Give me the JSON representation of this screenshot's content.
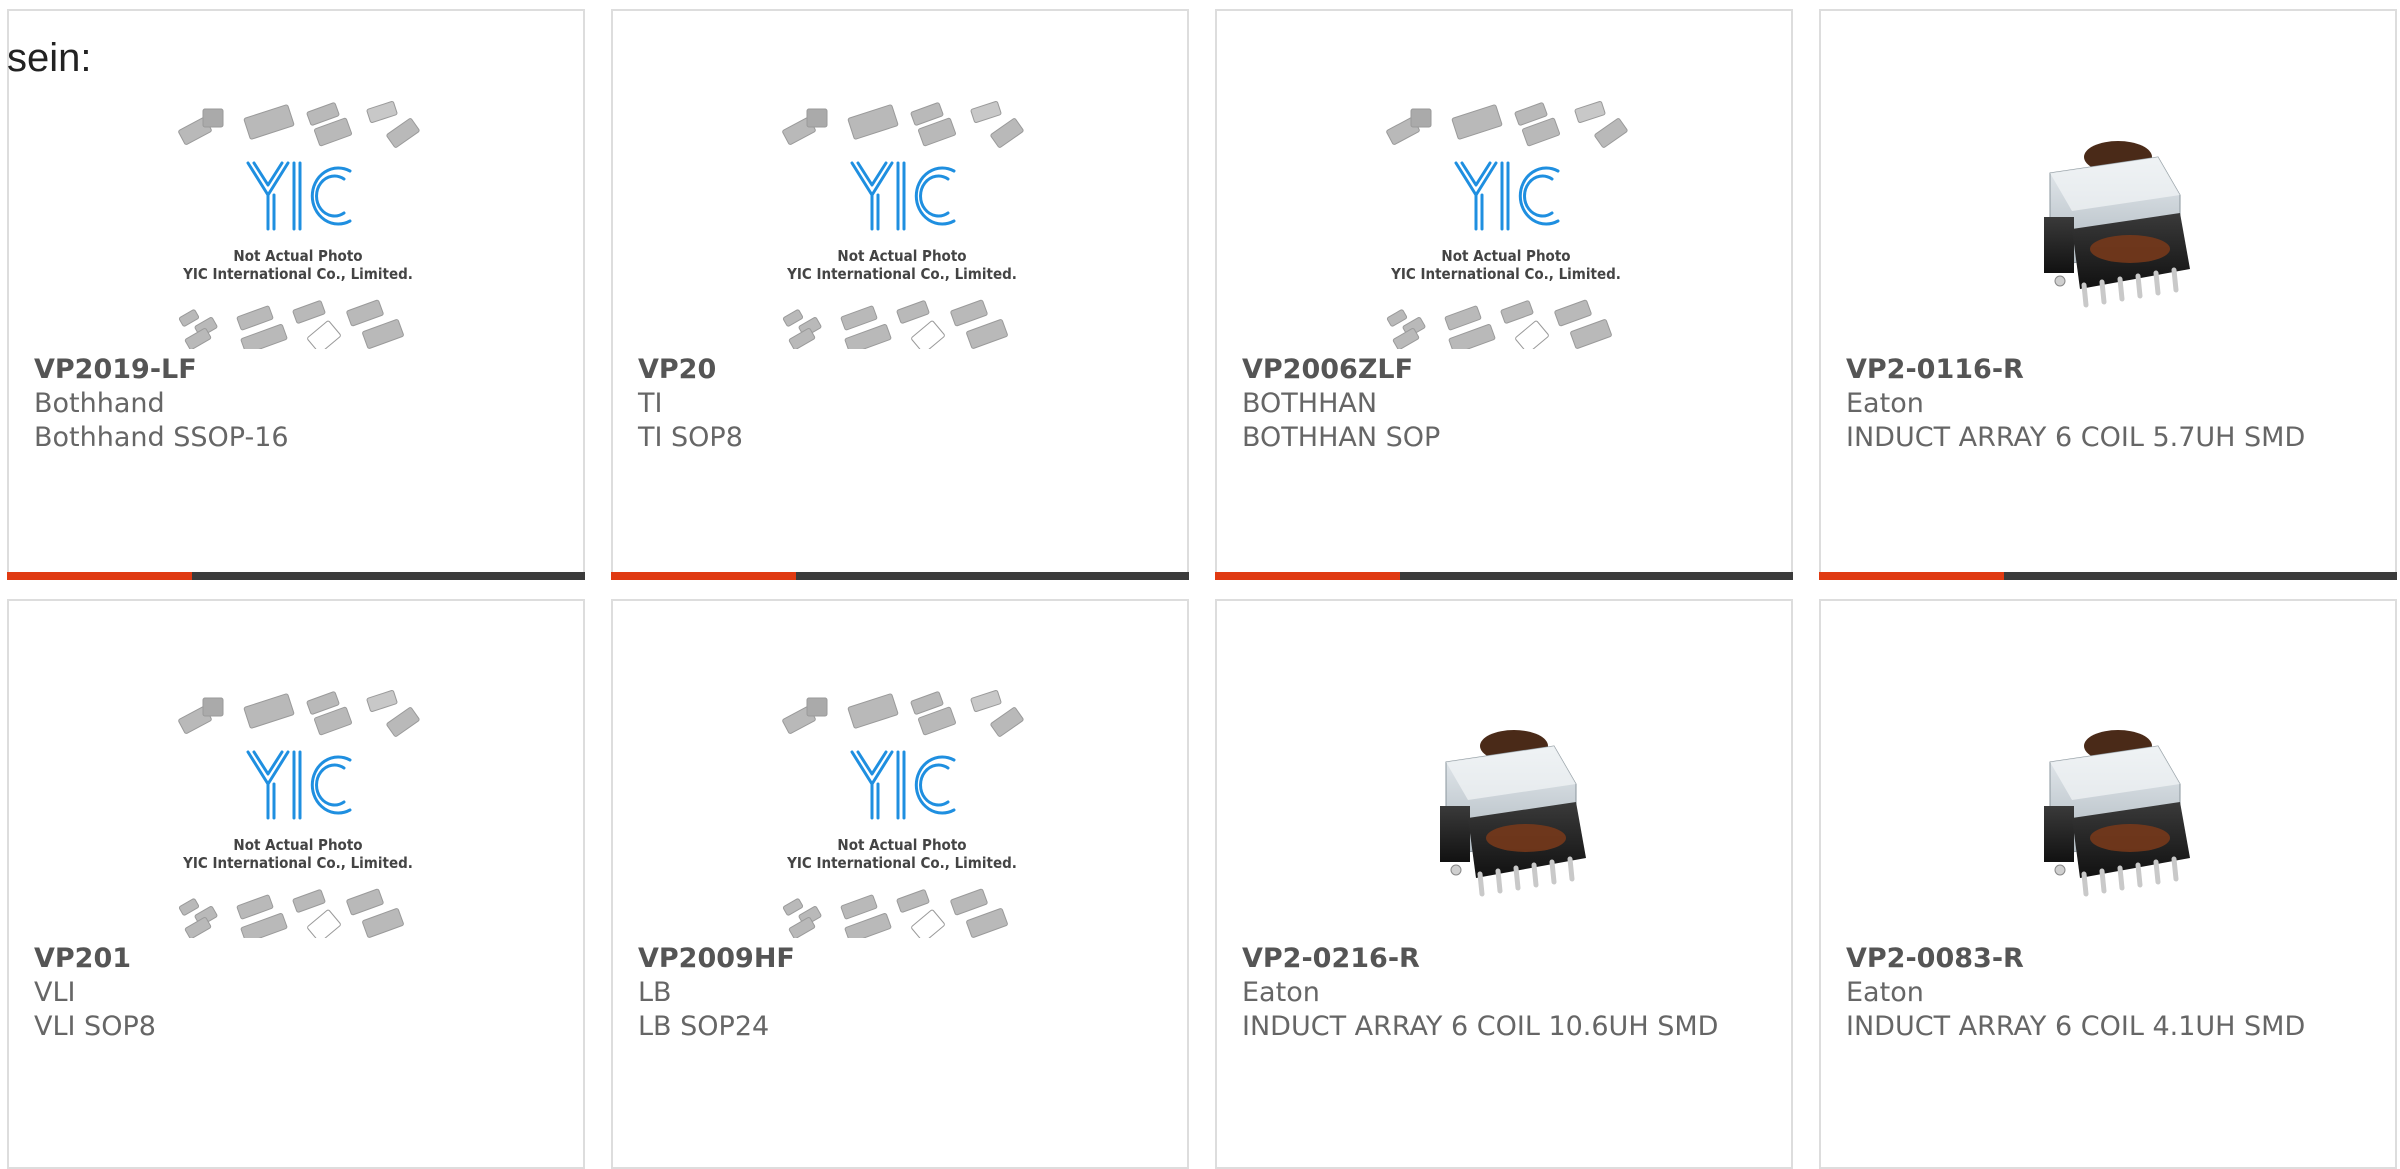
{
  "page_prefix": "sein:",
  "placeholder": {
    "line1": "Not Actual Photo",
    "line2": "YIC International Co., Limited.",
    "logo": "YIC"
  },
  "colors": {
    "card_border": "#dddddd",
    "accent": "#e03a12",
    "bar_track": "#3b3b3b",
    "logo_blue": "#1f8fe0",
    "text": "#666666"
  },
  "progress": 0.32,
  "products": [
    {
      "part_number": "VP2019-LF",
      "maker": "Bothhand",
      "description": "Bothhand SSOP-16",
      "image": "placeholder"
    },
    {
      "part_number": "VP20",
      "maker": "TI",
      "description": "TI SOP8",
      "image": "placeholder"
    },
    {
      "part_number": "VP2006ZLF",
      "maker": "BOTHHAN",
      "description": "BOTHHAN SOP",
      "image": "placeholder"
    },
    {
      "part_number": "VP2-0116-R",
      "maker": "Eaton",
      "description": "INDUCT ARRAY 6 COIL 5.7UH SMD",
      "image": "inductor-photo"
    },
    {
      "part_number": "VP201",
      "maker": "VLI",
      "description": "VLI SOP8",
      "image": "placeholder"
    },
    {
      "part_number": "VP2009HF",
      "maker": "LB",
      "description": "LB SOP24",
      "image": "placeholder"
    },
    {
      "part_number": "VP2-0216-R",
      "maker": "Eaton",
      "description": "INDUCT ARRAY 6 COIL 10.6UH SMD",
      "image": "inductor-photo"
    },
    {
      "part_number": "VP2-0083-R",
      "maker": "Eaton",
      "description": "INDUCT ARRAY 6 COIL 4.1UH SMD",
      "image": "inductor-photo"
    }
  ]
}
